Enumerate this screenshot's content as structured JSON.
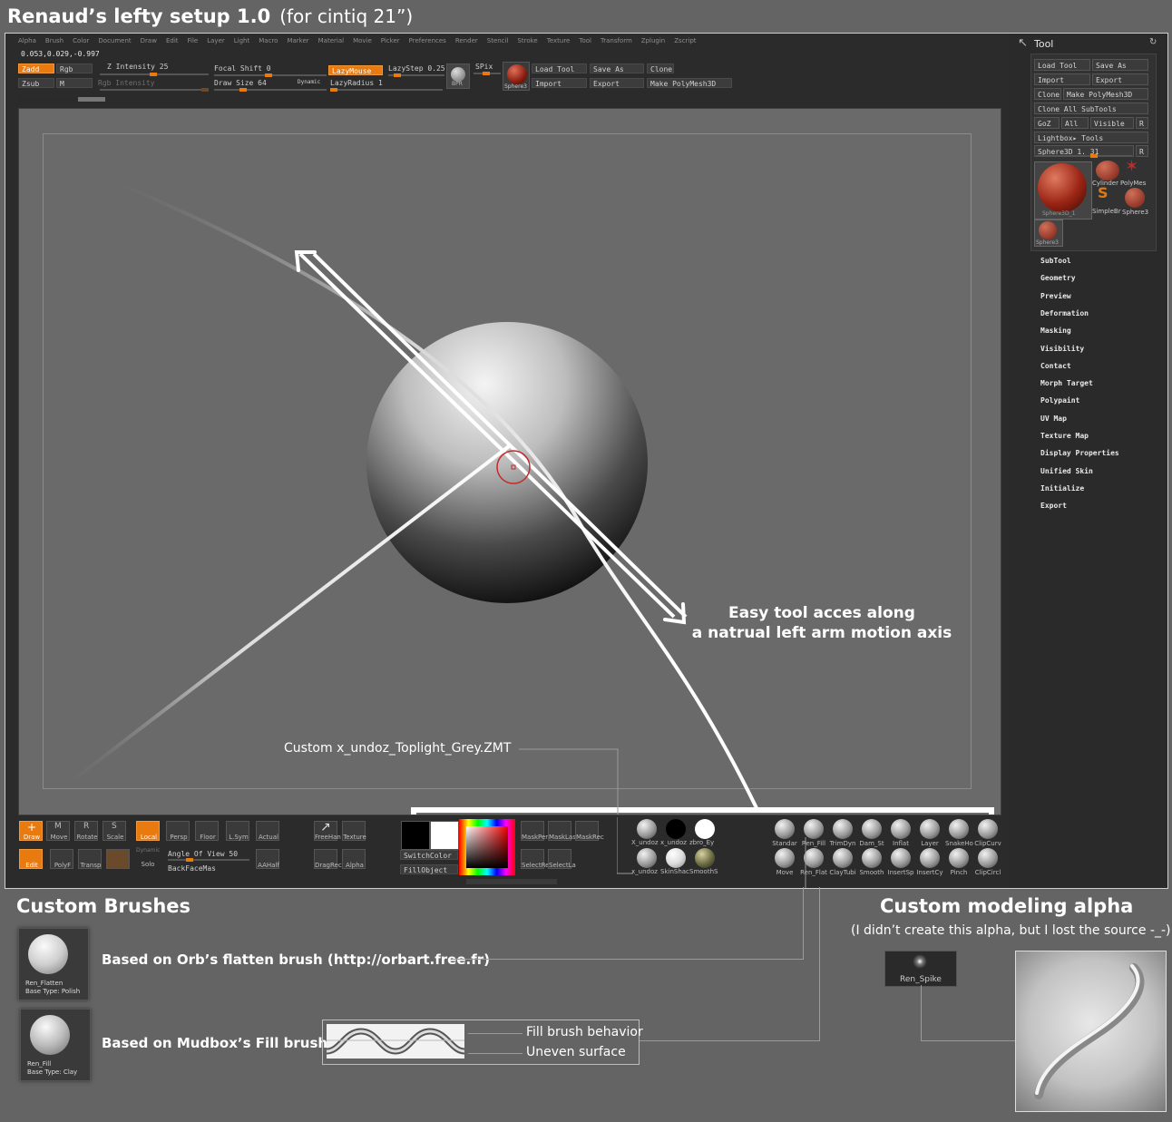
{
  "title": "Renaud’s lefty setup 1.0",
  "subtitle": "(for cintiq 21”)",
  "menu": [
    "Alpha",
    "Brush",
    "Color",
    "Document",
    "Draw",
    "Edit",
    "File",
    "Layer",
    "Light",
    "Macro",
    "Marker",
    "Material",
    "Movie",
    "Picker",
    "Preferences",
    "Render",
    "Stencil",
    "Stroke",
    "Texture",
    "Tool",
    "Transform",
    "Zplugin",
    "Zscript"
  ],
  "top": {
    "coords": "0.053,0.029,-0.997",
    "zadd": "Zadd",
    "rgb": "Rgb",
    "zsub": "Zsub",
    "m": "M",
    "z_intensity": "Z Intensity 25",
    "rgb_intensity": "Rgb Intensity",
    "focal_shift": "Focal Shift 0",
    "draw_size": "Draw Size 64",
    "dynamic": "Dynamic",
    "lazymouse": "LazyMouse",
    "lazyradius": "LazyRadius 1",
    "lazystep": "LazyStep 0.25",
    "bpr": "BPR",
    "spix": "SPix",
    "sphere3": "Sphere3",
    "load_tool": "Load Tool",
    "save_as": "Save As",
    "clone": "Clone",
    "import": "Import",
    "export": "Export",
    "make_polymesh": "Make PolyMesh3D"
  },
  "viewport": {
    "callout": [
      "Easy tool acces along",
      "a natrual left arm motion axis"
    ],
    "matcap_label": "Custom x_undoz_Toplight_Grey.ZMT"
  },
  "shelf_left": [
    {
      "label": "Draw",
      "active": true
    },
    {
      "label": "Move"
    },
    {
      "label": "Rotate"
    },
    {
      "label": "Scale"
    },
    {
      "label": "Local",
      "active": true
    },
    {
      "label": "Persp"
    },
    {
      "label": "Floor"
    },
    {
      "label": "L.Sym"
    },
    {
      "label": "Actual"
    }
  ],
  "shelf_left2": [
    {
      "label": "Edit",
      "active": true
    },
    {
      "label": "PolyF"
    },
    {
      "label": "Transp"
    },
    {
      "label": "Solo"
    },
    {
      "label": "AAHalf"
    }
  ],
  "shelf_misc": {
    "angle_of_view": "Angle Of View 50",
    "backface": "BackFaceMas",
    "dynamic2": "Dynamic",
    "freehand": "FreeHan",
    "texture": "Texture",
    "dragrect": "DragRec",
    "alpha": "Alpha",
    "switchcolor": "SwitchColor",
    "fillobject": "FillObject",
    "maskper": "MaskPer",
    "masklas": "MaskLas",
    "maskrec": "MaskRec",
    "selectre": "SelectRe",
    "selectla": "SelectLa",
    "mat1": "X_undoz",
    "mat2": "x_undoz",
    "mat3": "zbro_Ey",
    "mat4": "x_undoz",
    "mat5": "SkinShac",
    "mat6": "SmoothS"
  },
  "brushes_top": [
    "Standar",
    "Ren_Fill",
    "TrimDyn",
    "Dam_St",
    "Inflat",
    "Layer",
    "SnakeHo",
    "ClipCurv"
  ],
  "brushes_bottom": [
    "Move",
    "Ren_Flat",
    "ClayTubi",
    "Smooth",
    "InsertSp",
    "InsertCy",
    "Pinch",
    "ClipCircl"
  ],
  "tool": {
    "title": "Tool",
    "buttons": {
      "load_tool": "Load Tool",
      "save_as": "Save As",
      "import": "Import",
      "export": "Export",
      "clone": "Clone",
      "make_polymesh": "Make PolyMesh3D",
      "clone_all": "Clone All SubTools",
      "goz": "GoZ",
      "all": "All",
      "visible": "Visible",
      "r": "R",
      "lightbox": "Lightbox▸ Tools",
      "sphere": "Sphere3D_1. 31",
      "r2": "R"
    },
    "thumbs": {
      "main": "Sphere3D_1",
      "cylinder": "Cylinder",
      "polymesh": "PolyMes",
      "simplebr": "SimpleBr",
      "sphere3": "Sphere3",
      "sphere3b": "Sphere3"
    },
    "menu": [
      "SubTool",
      "Geometry",
      "Preview",
      "Deformation",
      "Masking",
      "Visibility",
      "Contact",
      "Morph Target",
      "Polypaint",
      "UV Map",
      "Texture Map",
      "Display Properties",
      "Unified Skin",
      "Initialize",
      "Export"
    ]
  },
  "lower": {
    "custom_brushes": "Custom Brushes",
    "flatten_note": "Based on Orb’s flatten brush (http://orbart.free.fr)",
    "fill_note": "Based on Mudbox’s Fill brush",
    "card1": {
      "name": "Ren_Flatten",
      "type": "Base Type: Polish"
    },
    "card2": {
      "name": "Ren_Fill",
      "type": "Base Type: Clay"
    },
    "fill_behavior": "Fill brush behavior",
    "uneven": "Uneven surface",
    "alpha_title": "Custom modeling alpha",
    "alpha_note": "(I didn’t create this alpha, but I lost the source -_-)",
    "alpha_name": "Ren_Spike"
  }
}
